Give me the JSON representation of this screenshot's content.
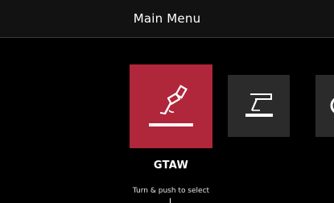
{
  "header": {
    "title": "Main Menu"
  },
  "menu": {
    "items": [
      {
        "label": "GTAW",
        "icon": "tig-torch-icon",
        "selected": true
      },
      {
        "icon": "stick-electrode-icon",
        "selected": false
      },
      {
        "icon": "next-process-icon",
        "selected": false
      }
    ]
  },
  "footer": {
    "hint": "Turn & push to select"
  },
  "colors": {
    "background": "#000000",
    "header_bg": "#121212",
    "selected_tile": "#b0263a",
    "tile": "#2b2b2b",
    "text": "#ffffff"
  }
}
